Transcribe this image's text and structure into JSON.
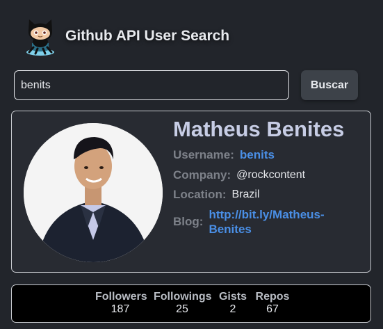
{
  "app": {
    "title": "Github API User Search"
  },
  "search": {
    "value": "benits",
    "button_label": "Buscar"
  },
  "profile": {
    "name": "Matheus Benites",
    "username_label": "Username:",
    "username": "benits",
    "company_label": "Company:",
    "company": "@rockcontent",
    "location_label": "Location:",
    "location": "Brazil",
    "blog_label": "Blog:",
    "blog_line1": "http://bit.ly/Matheus-",
    "blog_line2": "Benites"
  },
  "stats": [
    {
      "label": "Followers",
      "value": "187"
    },
    {
      "label": "Followings",
      "value": "25"
    },
    {
      "label": "Gists",
      "value": "2"
    },
    {
      "label": "Repos",
      "value": "67"
    }
  ],
  "colors": {
    "background": "#22252b",
    "accent_link": "#4a8fe6",
    "name_color": "#c7cde5"
  }
}
